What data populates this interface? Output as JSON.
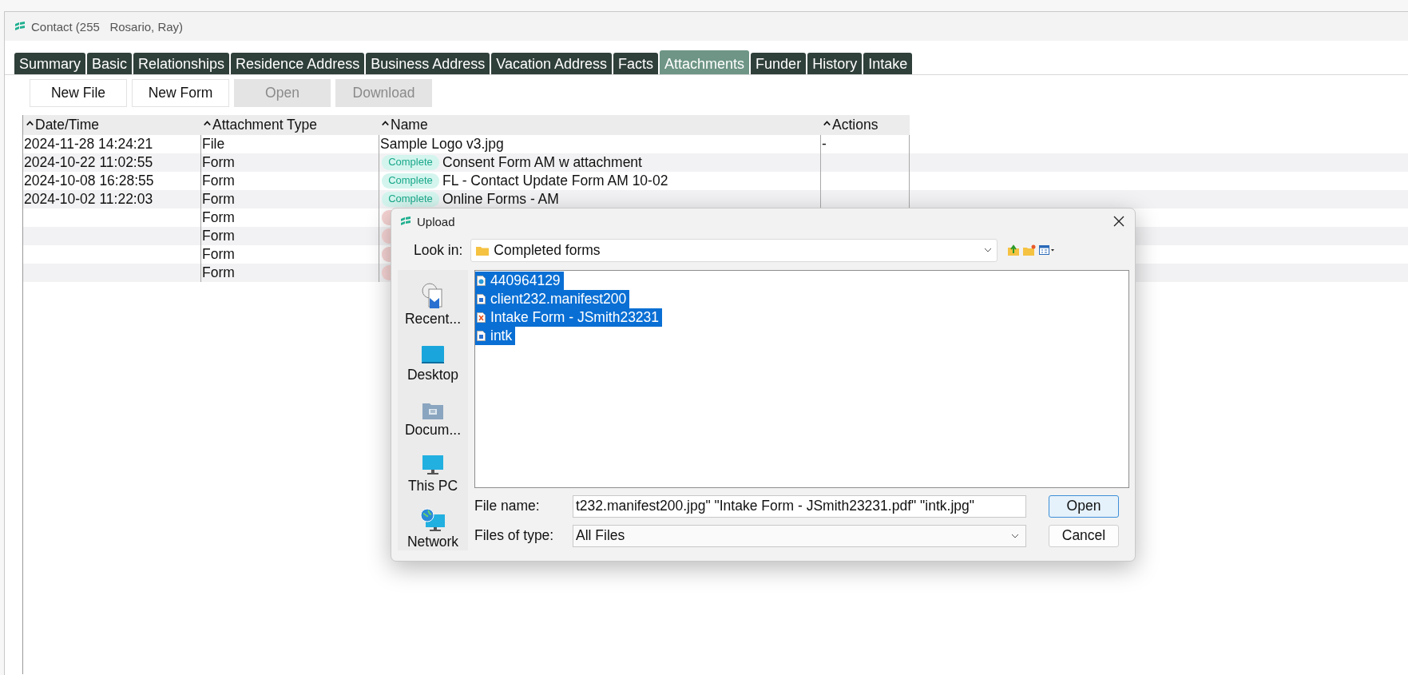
{
  "window": {
    "title": "Contact (255   Rosario, Ray)"
  },
  "tabs": [
    {
      "label": "Summary",
      "selected": false
    },
    {
      "label": "Basic",
      "selected": false
    },
    {
      "label": "Relationships",
      "selected": false
    },
    {
      "label": "Residence Address",
      "selected": false
    },
    {
      "label": "Business Address",
      "selected": false
    },
    {
      "label": "Vacation Address",
      "selected": false
    },
    {
      "label": "Facts",
      "selected": false
    },
    {
      "label": "Attachments",
      "selected": true
    },
    {
      "label": "Funder",
      "selected": false
    },
    {
      "label": "History",
      "selected": false
    },
    {
      "label": "Intake",
      "selected": false
    }
  ],
  "toolbar": [
    {
      "label": "New File",
      "disabled": false
    },
    {
      "label": "New Form",
      "disabled": false
    },
    {
      "label": "Open",
      "disabled": true
    },
    {
      "label": "Download",
      "disabled": true
    }
  ],
  "table": {
    "columns": [
      {
        "label": "Date/Time",
        "sort_ascending": true
      },
      {
        "label": "Attachment Type",
        "sort_ascending": true
      },
      {
        "label": "Name",
        "sort_ascending": true
      },
      {
        "label": "Actions",
        "sort_ascending": true
      }
    ],
    "rows": [
      {
        "date": "2024-11-28 14:24:21",
        "type": "File",
        "name": "Sample Logo v3.jpg",
        "actions": "-"
      },
      {
        "date": "2024-10-22 11:02:55",
        "type": "Form",
        "badge": {
          "color": "#d4f5ee",
          "label": "Complete"
        },
        "name": "Consent Form AM w attachment"
      },
      {
        "date": "2024-10-08 16:28:55",
        "type": "Form",
        "badge": {
          "color": "#d4f5ee",
          "label": "Complete"
        },
        "name": "FL - Contact Update Form AM 10-02"
      },
      {
        "date": "2024-10-02 11:22:03",
        "type": "Form",
        "badge": {
          "color": "#d4f5ee",
          "label": "Complete"
        },
        "name": "Online Forms - AM"
      },
      {
        "type": "Form",
        "hidden_badge": true
      },
      {
        "type": "Form",
        "hidden_badge": true
      },
      {
        "type": "Form",
        "hidden_badge": true
      },
      {
        "type": "Form",
        "hidden_badge": true
      }
    ]
  },
  "dialog": {
    "title": "Upload",
    "look_in": {
      "label": "Look in:",
      "value": "Completed forms"
    },
    "places": [
      {
        "label": "Recent...",
        "kind": "recent"
      },
      {
        "label": "Desktop",
        "kind": "desktop"
      },
      {
        "label": "Docum...",
        "kind": "documents"
      },
      {
        "label": "This PC",
        "kind": "computer"
      },
      {
        "label": "Network",
        "kind": "network"
      }
    ],
    "files": [
      {
        "name": "440964129",
        "kind": "web",
        "selected": true
      },
      {
        "name": "client232.manifest200",
        "kind": "image",
        "selected": true
      },
      {
        "name": "Intake Form - JSmith23231",
        "kind": "pdf",
        "selected": true
      },
      {
        "name": "intk",
        "kind": "image",
        "selected": true
      }
    ],
    "file_name": {
      "label": "File name:",
      "value": "t232.manifest200.jpg\" \"Intake Form - JSmith23231.pdf\" \"intk.jpg\""
    },
    "file_type": {
      "label": "Files of type:",
      "value": "All Files"
    },
    "buttons": [
      {
        "label": "Open",
        "default": true
      },
      {
        "label": "Cancel",
        "default": false
      }
    ]
  }
}
